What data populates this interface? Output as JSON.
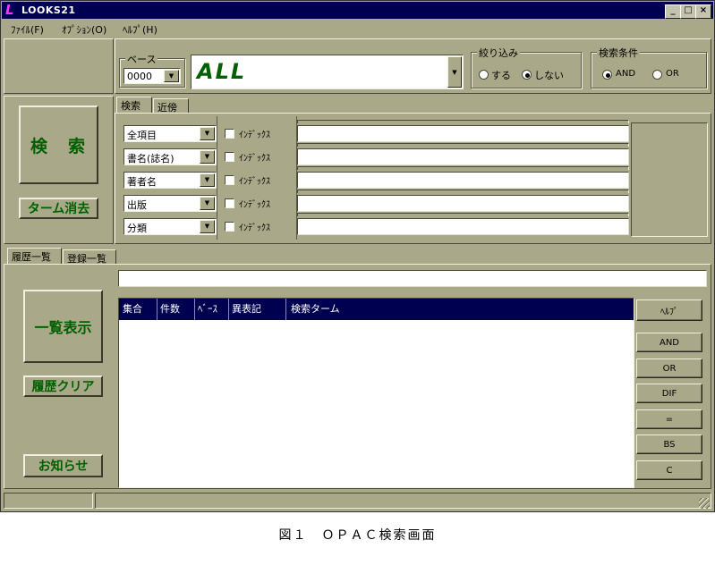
{
  "window": {
    "title": "LOOKS21",
    "minimize": "_",
    "maximize": "□",
    "close": "×"
  },
  "menu": {
    "file": "ﾌｧｲﾙ(F)",
    "options": "ｵﾌﾟｼｮﾝ(O)",
    "help": "ﾍﾙﾌﾟ(H)"
  },
  "base": {
    "group_label": "ベース",
    "value": "0000",
    "display": "ALL"
  },
  "narrow": {
    "group_label": "絞り込み",
    "option_yes": "する",
    "option_no": "しない",
    "selected": "しない"
  },
  "condition": {
    "group_label": "検索条件",
    "option_and": "AND",
    "option_or": "OR",
    "selected": "AND"
  },
  "search_tabs": {
    "search": "検索",
    "proximity": "近傍"
  },
  "buttons": {
    "search": "検　索",
    "clear_terms": "ターム消去",
    "list_display": "一覧表示",
    "clear_history": "履歴クリア",
    "notice": "お知らせ"
  },
  "search_rows": [
    {
      "field": "全項目",
      "index_label": "ｲﾝﾃﾞｯｸｽ",
      "value": ""
    },
    {
      "field": "書名(誌名)",
      "index_label": "ｲﾝﾃﾞｯｸｽ",
      "value": ""
    },
    {
      "field": "著者名",
      "index_label": "ｲﾝﾃﾞｯｸｽ",
      "value": ""
    },
    {
      "field": "出版",
      "index_label": "ｲﾝﾃﾞｯｸｽ",
      "value": ""
    },
    {
      "field": "分類",
      "index_label": "ｲﾝﾃﾞｯｸｽ",
      "value": ""
    }
  ],
  "history_tabs": {
    "history": "履歴一覧",
    "registered": "登録一覧"
  },
  "history_table": {
    "columns": [
      "集合",
      "件数",
      "ﾍﾞｰｽ",
      "異表記",
      "検索ターム"
    ]
  },
  "side_buttons": {
    "help": "ﾍﾙﾌﾟ",
    "and": "AND",
    "or": "OR",
    "dif": "DIF",
    "eq": "=",
    "bs": "BS",
    "c": "C"
  },
  "caption": "図１　ＯＰＡＣ検索画面"
}
